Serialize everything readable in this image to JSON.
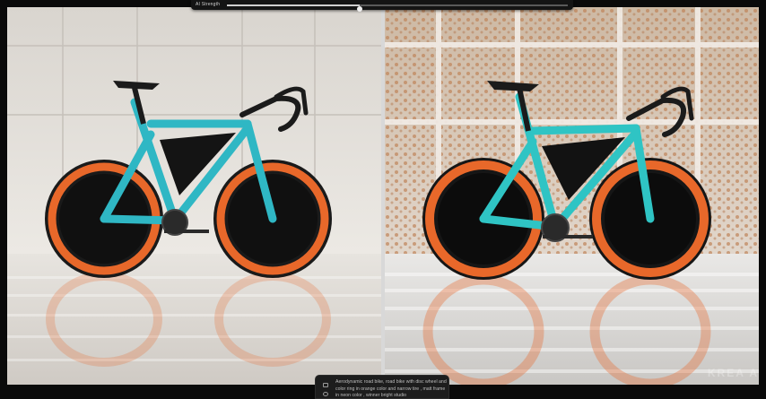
{
  "strength": {
    "label": "AI Strength",
    "value": 0.39
  },
  "left_image": {
    "alt": "Generated road bike image - version A"
  },
  "right_image": {
    "alt": "Generated road bike image - version B"
  },
  "prompt": {
    "text": "Aerodynamic road bike, road bike with disc wheel and color ring in orange color and narrow tire , matt frame in neon color , winner bright studio"
  },
  "branding": {
    "logo": "KREA A"
  },
  "icons": {
    "image": "image-icon",
    "settings": "sliders-icon"
  },
  "colors": {
    "frame": "#2fb7c4",
    "rim": "#e8682a",
    "background": "#0a0a0a"
  }
}
